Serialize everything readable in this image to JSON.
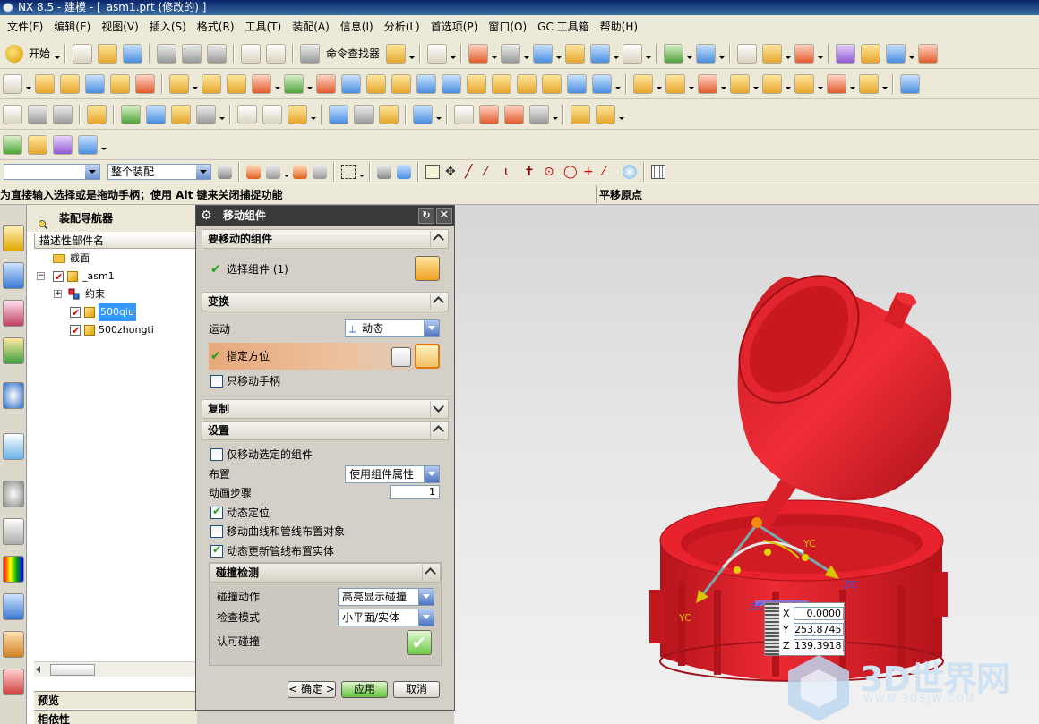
{
  "window": {
    "title": "NX 8.5 - 建模 - [_asm1.prt  (修改的) ]"
  },
  "menu": {
    "start_label": "开始",
    "items": [
      "文件(F)",
      "编辑(E)",
      "视图(V)",
      "插入(S)",
      "格式(R)",
      "工具(T)",
      "装配(A)",
      "信息(I)",
      "分析(L)",
      "首选项(P)",
      "窗口(O)",
      "GC 工具箱",
      "帮助(H)"
    ]
  },
  "toolbar": {
    "start_label": "开始",
    "command_finder_label": "命令查找器"
  },
  "selection_bar": {
    "filter_value": "",
    "scope_value": "整个装配"
  },
  "cue_line": {
    "cue": "为直接输入选择或是拖动手柄；使用 Alt 键来关闭捕捉功能",
    "status": "平移原点"
  },
  "navigator": {
    "title": "装配导航器",
    "column_header": "描述性部件名",
    "rows": [
      {
        "label": "截面"
      },
      {
        "label": "_asm1"
      },
      {
        "label": "约束"
      },
      {
        "label": "500qiu"
      },
      {
        "label": "500zhongti"
      }
    ],
    "preview_label": "预览",
    "dependency_label": "相依性"
  },
  "dialog": {
    "title": "移动组件",
    "section_components": "要移动的组件",
    "select_component": "选择组件 (1)",
    "section_transform": "变换",
    "motion_label": "运动",
    "motion_value": "动态",
    "specify_orientation": "指定方位",
    "move_handle_only": "只移动手柄",
    "section_copy": "复制",
    "section_settings": "设置",
    "move_selected_only": "仅移动选定的组件",
    "layout_label": "布置",
    "layout_value": "使用组件属性",
    "anim_steps_label": "动画步骤",
    "anim_steps_value": "1",
    "dynamic_positioning": "动态定位",
    "move_curves": "移动曲线和管线布置对象",
    "dynamic_update": "动态更新管线布置实体",
    "collision_section": "碰撞检测",
    "collision_action_label": "碰撞动作",
    "collision_action_value": "高亮显示碰撞",
    "check_mode_label": "检查模式",
    "check_mode_value": "小平面/实体",
    "accept_collision_label": "认可碰撞",
    "ok_label": "< 确定 >",
    "apply_label": "应用",
    "cancel_label": "取消",
    "checkboxes": {
      "move_handle_only": false,
      "move_selected_only": false,
      "dynamic_positioning": true,
      "move_curves": false,
      "dynamic_update": true
    }
  },
  "coords": {
    "x_label": "X",
    "y_label": "Y",
    "z_label": "Z",
    "x": "0.0000",
    "y": "253.8745",
    "z": "139.3918"
  },
  "handles": {
    "yc_top": "YC",
    "yc_bottom": "YC",
    "zc_right": "ZC",
    "zc_left": "ZC"
  },
  "watermark": {
    "title": "3D世界网",
    "url": "WWW.3DSJW.COM"
  },
  "colors": {
    "model_red": "#e8232e",
    "dialog_bg": "#d4d0c8",
    "title_dark": "#3a3a3a",
    "accent_orange": "#e7a97c"
  }
}
